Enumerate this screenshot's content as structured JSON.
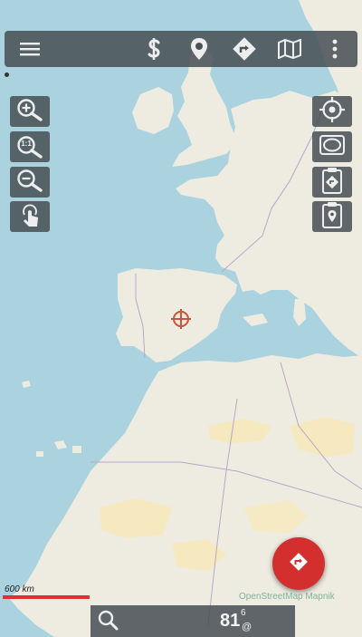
{
  "toolbar": {
    "items": [
      {
        "name": "menu-icon"
      },
      {
        "name": "dollar-icon"
      },
      {
        "name": "location-pin-icon"
      },
      {
        "name": "route-icon"
      },
      {
        "name": "map-icon"
      },
      {
        "name": "more-vertical-icon"
      }
    ]
  },
  "left_controls": [
    {
      "name": "zoom-in-icon"
    },
    {
      "name": "zoom-1to1-icon",
      "label": "1:1"
    },
    {
      "name": "zoom-out-icon"
    },
    {
      "name": "touch-icon"
    }
  ],
  "right_controls": [
    {
      "name": "crosshair-target-icon"
    },
    {
      "name": "map-view-icon"
    },
    {
      "name": "clipboard-route-icon"
    },
    {
      "name": "clipboard-location-icon"
    }
  ],
  "map": {
    "marker": "crosshair-marker",
    "scale_label": "600 km",
    "attribution": "OpenStreetMap Mapnik"
  },
  "bottom_bar": {
    "search_icon": "search-icon",
    "satellites": "81",
    "satellites_superscript": "6",
    "satellites_suffix": "@"
  },
  "fab": {
    "icon": "route-arrow-icon"
  },
  "colors": {
    "water": "#aad3df",
    "land": "#eeebe1",
    "desert": "#f7e9b8",
    "bar_bg": "#464e54",
    "fab": "#d32f2f",
    "scale": "#e03030",
    "marker": "#c8553a"
  }
}
